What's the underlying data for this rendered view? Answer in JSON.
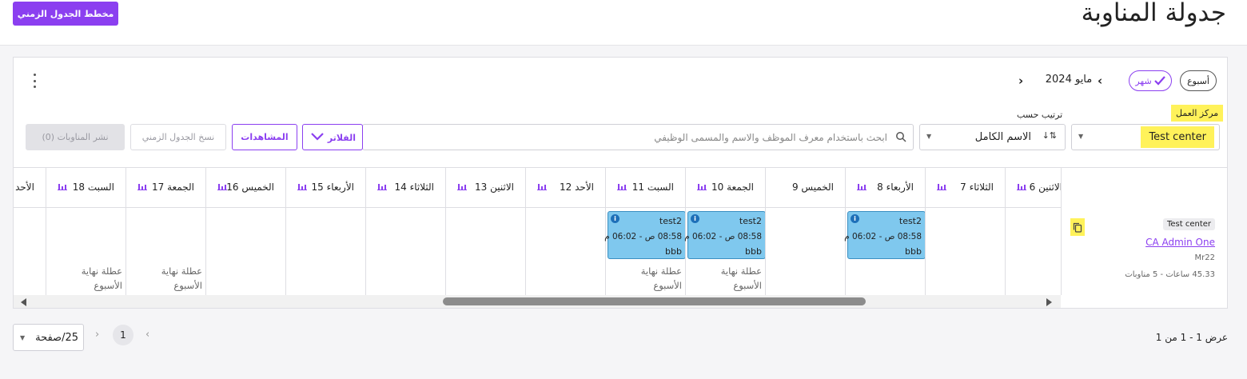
{
  "header": {
    "title": "جدولة المناوبة",
    "timeline_button": "مخطط الجدول الزمني"
  },
  "toolbar": {
    "view_week": "أسبوع",
    "view_month": "شهر",
    "current_period": "مايو 2024",
    "work_center_label": "مركز العمل",
    "work_center_value": "Test center",
    "sort_label": "ترتيب حسب",
    "sort_value": "الاسم الكامل",
    "search_placeholder": "ابحث باستخدام معرف الموظف والاسم والمسمى الوظيفي",
    "filters_label": "الفلاتر",
    "views_label": "المشاهدات",
    "copy_schedule_label": "نسخ الجدول الزمني",
    "publish_label": "نشر المناوبات (0)"
  },
  "columns": [
    {
      "label": "الأحد"
    },
    {
      "label": "السبت 18"
    },
    {
      "label": "الجمعة 17"
    },
    {
      "label": "الخميس 16"
    },
    {
      "label": "الأربعاء 15"
    },
    {
      "label": "الثلاثاء 14"
    },
    {
      "label": "الاثنين 13"
    },
    {
      "label": "الأحد 12"
    },
    {
      "label": "السبت 11"
    },
    {
      "label": "الجمعة 10"
    },
    {
      "label": "الخميس 9"
    },
    {
      "label": "الأربعاء 8"
    },
    {
      "label": "الثلاثاء 7"
    },
    {
      "label": "الاثنين 6"
    }
  ],
  "employee": {
    "badge": "Test center",
    "name": "CA Admin One",
    "code": "Mr22",
    "stats": "45.33 ساعات - 5 مناوبات"
  },
  "shifts": [
    {
      "title": "test2",
      "time": "08:58 ص - 06:02 م",
      "note": "bbb"
    },
    {
      "title": "test2",
      "time": "08:58 ص - 06:02 م",
      "note": "bbb"
    },
    {
      "title": "test2",
      "time": "08:58 ص - 06:02 م",
      "note": "bbb"
    }
  ],
  "weekend_line1": "عطلة نهاية",
  "weekend_line2": "الأسبوع",
  "pagination": {
    "per_page": "25/صفحة",
    "current_page": "1",
    "summary": "عرض 1 - 1 من 1"
  },
  "colors": {
    "accent": "#8b3ff0",
    "shift_fill": "#7fc8ee",
    "highlight": "#fff25a"
  },
  "icons": [
    "menu-dots-icon",
    "check-icon",
    "chevron-left-icon",
    "chevron-right-icon",
    "sort-icon",
    "search-icon",
    "chevron-down-icon",
    "bar-chart-icon",
    "info-icon",
    "copy-icon",
    "caret-down-icon"
  ]
}
